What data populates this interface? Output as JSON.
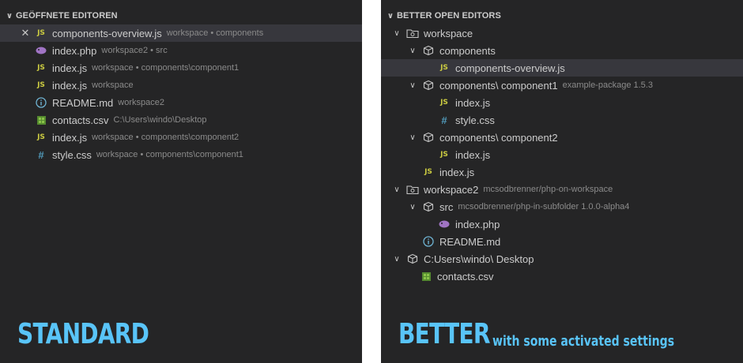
{
  "left": {
    "header": "GEÖFFNETE EDITOREN",
    "files": [
      {
        "icon": "js",
        "name": "components-overview.js",
        "desc": "workspace • components",
        "selected": true
      },
      {
        "icon": "php",
        "name": "index.php",
        "desc": "workspace2 • src"
      },
      {
        "icon": "js",
        "name": "index.js",
        "desc": "workspace • components\\component1"
      },
      {
        "icon": "js",
        "name": "index.js",
        "desc": "workspace"
      },
      {
        "icon": "info",
        "name": "README.md",
        "desc": "workspace2"
      },
      {
        "icon": "csv",
        "name": "contacts.csv",
        "desc": "C:\\Users\\windo\\Desktop"
      },
      {
        "icon": "js",
        "name": "index.js",
        "desc": "workspace • components\\component2"
      },
      {
        "icon": "css",
        "name": "style.css",
        "desc": "workspace • components\\component1"
      }
    ],
    "caption": "STANDARD"
  },
  "right": {
    "header": "BETTER OPEN EDITORS",
    "tree": [
      {
        "depth": 0,
        "chevron": true,
        "icon": "root",
        "name": "workspace",
        "desc": ""
      },
      {
        "depth": 1,
        "chevron": true,
        "icon": "box",
        "name": "components",
        "desc": ""
      },
      {
        "depth": 2,
        "chevron": false,
        "icon": "js",
        "name": "components-overview.js",
        "desc": "",
        "selected": true
      },
      {
        "depth": 1,
        "chevron": true,
        "icon": "box",
        "name": "components\\ component1",
        "desc": "example-package 1.5.3"
      },
      {
        "depth": 2,
        "chevron": false,
        "icon": "js",
        "name": "index.js",
        "desc": ""
      },
      {
        "depth": 2,
        "chevron": false,
        "icon": "css",
        "name": "style.css",
        "desc": ""
      },
      {
        "depth": 1,
        "chevron": true,
        "icon": "box",
        "name": "components\\ component2",
        "desc": ""
      },
      {
        "depth": 2,
        "chevron": false,
        "icon": "js",
        "name": "index.js",
        "desc": ""
      },
      {
        "depth": 1,
        "chevron": false,
        "icon": "js",
        "name": "index.js",
        "desc": ""
      },
      {
        "depth": 0,
        "chevron": true,
        "icon": "root",
        "name": "workspace2",
        "desc": "mcsodbrenner/php-on-workspace"
      },
      {
        "depth": 1,
        "chevron": true,
        "icon": "box",
        "name": "src",
        "desc": "mcsodbrenner/php-in-subfolder 1.0.0-alpha4"
      },
      {
        "depth": 2,
        "chevron": false,
        "icon": "php",
        "name": "index.php",
        "desc": ""
      },
      {
        "depth": 1,
        "chevron": false,
        "icon": "info",
        "name": "README.md",
        "desc": ""
      },
      {
        "depth": 0,
        "chevron": true,
        "icon": "box",
        "name": "C:Users\\windo\\ Desktop",
        "desc": ""
      },
      {
        "depth": 1,
        "chevron": false,
        "icon": "csv",
        "name": "contacts.csv",
        "desc": ""
      }
    ],
    "caption": "BETTER",
    "caption_sub": "with some activated settings"
  },
  "colors": {
    "js": "#cbcb41",
    "css": "#519aba",
    "php": "#a074c4",
    "info": "#6fb3d2",
    "csv": "#8bc34a",
    "caption": "#59c4f8",
    "selected": "#37373d"
  }
}
